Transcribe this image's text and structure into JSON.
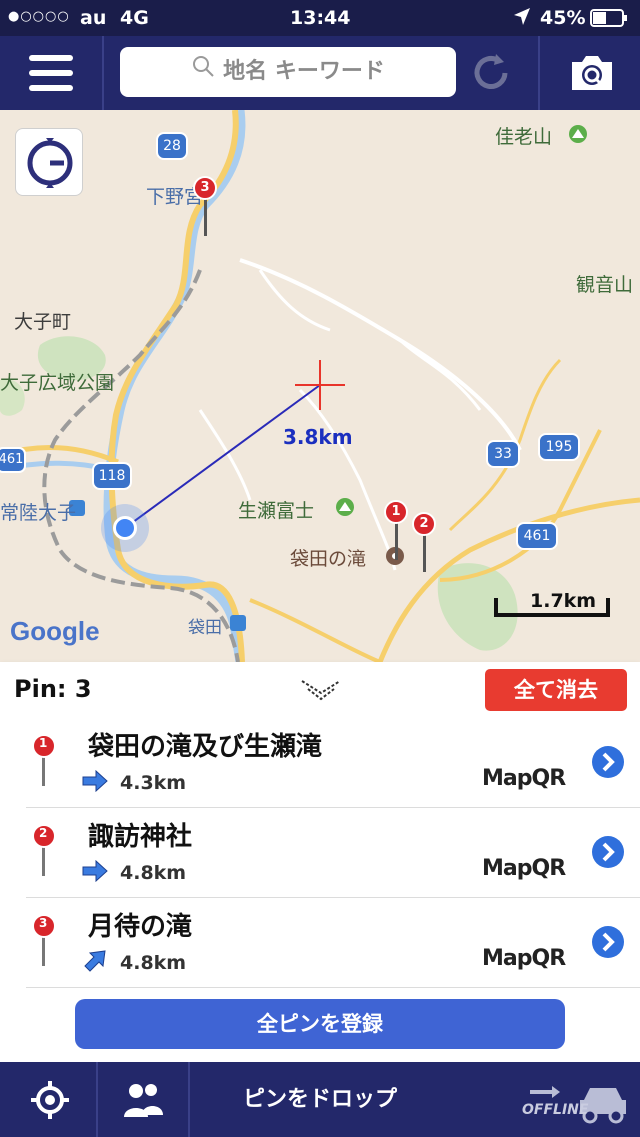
{
  "status_bar": {
    "signal": "●○○○○",
    "carrier": "au",
    "network": "4G",
    "time": "13:44",
    "battery": "45%"
  },
  "header": {
    "search_placeholder": "地名 キーワード"
  },
  "map": {
    "labels": {
      "kashirosan": "佳老山",
      "kannonyama": "観音山",
      "shimonomiya": "下野宮",
      "daigomachi": "大子町",
      "daigo_park": "大子広域公園",
      "hitachi_daigo": "常陸大子",
      "ubusefuji": "生瀬富士",
      "fukuroda_falls": "袋田の滝",
      "fukuroda": "袋田"
    },
    "road_shields": {
      "r28": "28",
      "r118": "118",
      "r461_left": "461",
      "r33": "33",
      "r195": "195",
      "r461_right": "461"
    },
    "distance_label": "3.8km",
    "scale_label": "1.7km",
    "logo": "Google",
    "pins": [
      "1",
      "2",
      "3"
    ]
  },
  "pin_bar": {
    "count_label": "Pin: 3",
    "clear_all_label": "全て消去"
  },
  "pin_list": [
    {
      "number": "1",
      "name": "袋田の滝及び生瀬滝",
      "distance": "4.3km",
      "badge": "MapQR",
      "direction": "east"
    },
    {
      "number": "2",
      "name": "諏訪神社",
      "distance": "4.8km",
      "badge": "MapQR",
      "direction": "east"
    },
    {
      "number": "3",
      "name": "月待の滝",
      "distance": "4.8km",
      "badge": "MapQR",
      "direction": "northeast"
    }
  ],
  "register_all_label": "全ピンを登録",
  "bottom_bar": {
    "drop_pin_label": "ピンをドロップ",
    "watermark_text": "OFFLINE"
  },
  "colors": {
    "nav_bg": "#23286a",
    "status_bg": "#1a1d4a",
    "clear_button": "#e83b30",
    "register_button": "#3f64d4",
    "distance_text": "#1b2fbf",
    "pin_red": "#d8262b",
    "arrow_blue": "#3a7be0"
  }
}
